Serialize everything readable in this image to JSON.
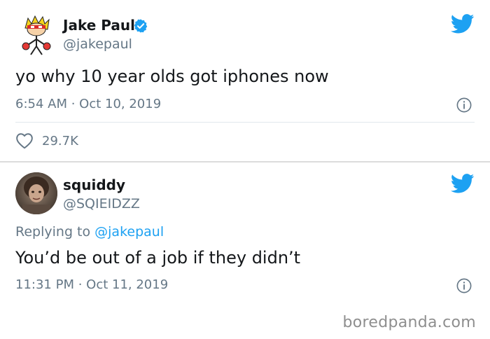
{
  "tweets": [
    {
      "display_name": "Jake Paul",
      "handle": "@jakepaul",
      "verified": true,
      "text": "yo why 10 year olds got iphones now",
      "timestamp": "6:54 AM · Oct 10, 2019",
      "likes": "29.7K",
      "icons": [
        "cartoon-avatar",
        "verified-badge-icon",
        "twitter-bird-icon",
        "info-icon",
        "heart-icon"
      ]
    },
    {
      "display_name": "squiddy",
      "handle": "@SQIEIDZZ",
      "replying_prefix": "Replying to ",
      "replying_to": "@jakepaul",
      "text": "You’d be out of a job if they didn’t",
      "timestamp": "11:31 PM · Oct 11, 2019",
      "icons": [
        "photo-avatar",
        "twitter-bird-icon",
        "info-icon"
      ]
    }
  ],
  "watermark": "boredpanda.com",
  "colors": {
    "twitter_blue": "#1da1f2",
    "text_primary": "#14171a",
    "text_secondary": "#657786",
    "divider": "#e1e8ed"
  }
}
